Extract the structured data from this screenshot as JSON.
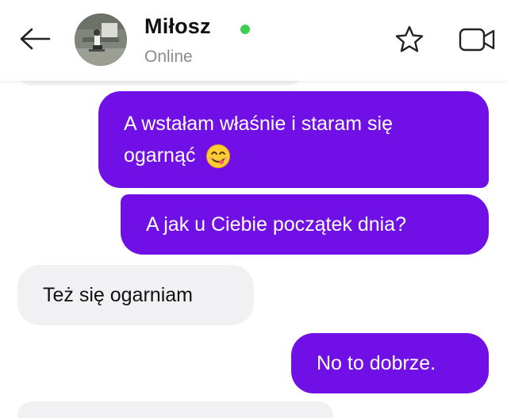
{
  "header": {
    "contact_name": "Miłosz",
    "status": "Online",
    "online_color": "#3fcf4e",
    "icons": [
      "arrow-left-icon",
      "star-icon",
      "video-camera-icon"
    ]
  },
  "messages": [
    {
      "direction": "outgoing",
      "line1": "A wstałam właśnie i staram się",
      "line2": "ogarnąć",
      "emoji": "smiling-face-with-tongue"
    },
    {
      "direction": "outgoing",
      "text": "A jak u Ciebie początek dnia?"
    },
    {
      "direction": "incoming",
      "text": "Też się ogarniam"
    },
    {
      "direction": "outgoing",
      "text": "No to dobrze."
    }
  ],
  "colors": {
    "outgoing_bubble": "#7110e6",
    "incoming_bubble": "#f1f1f3"
  }
}
